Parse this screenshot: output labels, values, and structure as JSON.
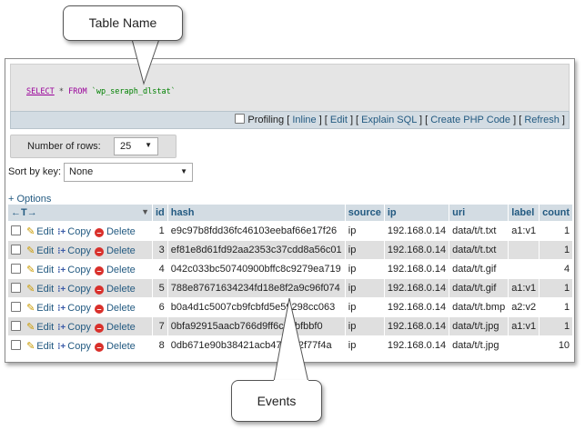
{
  "annotations": {
    "top_label": "Table Name",
    "bottom_label": "Events"
  },
  "sql": {
    "select_kw": "SELECT",
    "star": "*",
    "from_kw": "FROM",
    "table": "`wp_seraph_dlstat`"
  },
  "options_bar": {
    "profiling": "Profiling",
    "inline": "Inline",
    "edit": "Edit",
    "explain": "Explain SQL",
    "create_php": "Create PHP Code",
    "refresh": "Refresh"
  },
  "rows": {
    "label": "Number of rows:",
    "value": "25"
  },
  "sort": {
    "label": "Sort by key:",
    "value": "None"
  },
  "options_link": "+ Options",
  "table": {
    "nav_arrows": "←T→",
    "columns": [
      "id",
      "hash",
      "source",
      "ip",
      "uri",
      "label",
      "count"
    ],
    "actions": {
      "edit": "Edit",
      "copy": "Copy",
      "delete": "Delete"
    },
    "rows": [
      {
        "id": "1",
        "hash": "e9c97b8fdd36fc46103eebaf66e17f26",
        "source": "ip",
        "ip": "192.168.0.14",
        "uri": "data/t/t.txt",
        "label": "a1:v1",
        "count": "1"
      },
      {
        "id": "3",
        "hash": "ef81e8d61fd92aa2353c37cdd8a56c01",
        "source": "ip",
        "ip": "192.168.0.14",
        "uri": "data/t/t.txt",
        "label": "",
        "count": "1"
      },
      {
        "id": "4",
        "hash": "042c033bc50740900bffc8c9279ea719",
        "source": "ip",
        "ip": "192.168.0.14",
        "uri": "data/t/t.gif",
        "label": "",
        "count": "4"
      },
      {
        "id": "5",
        "hash": "788e87671634234fd18e8f2a9c96f074",
        "source": "ip",
        "ip": "192.168.0.14",
        "uri": "data/t/t.gif",
        "label": "a1:v1",
        "count": "1"
      },
      {
        "id": "6",
        "hash": "b0a4d1c5007cb9fcbfd5e59298cc063",
        "source": "ip",
        "ip": "192.168.0.14",
        "uri": "data/t/t.bmp",
        "label": "a2:v2",
        "count": "1"
      },
      {
        "id": "7",
        "hash": "0bfa92915aacb766d9ff6cb3bfbbf0",
        "source": "ip",
        "ip": "192.168.0.14",
        "uri": "data/t/t.jpg",
        "label": "a1:v1",
        "count": "1"
      },
      {
        "id": "8",
        "hash": "0db671e90b38421acb47e3e2f77f4a",
        "source": "ip",
        "ip": "192.168.0.14",
        "uri": "data/t/t.jpg",
        "label": "",
        "count": "10"
      }
    ]
  },
  "colors": {
    "header_bg": "#d3dce3",
    "link": "#235a81",
    "sql_keyword": "#990099",
    "sql_table": "#008000",
    "row_alt": "#dfdfdf"
  },
  "icons": [
    "pencil-icon",
    "copy-icon",
    "delete-icon",
    "dropdown-arrow-icon",
    "sort-arrow-icon"
  ]
}
